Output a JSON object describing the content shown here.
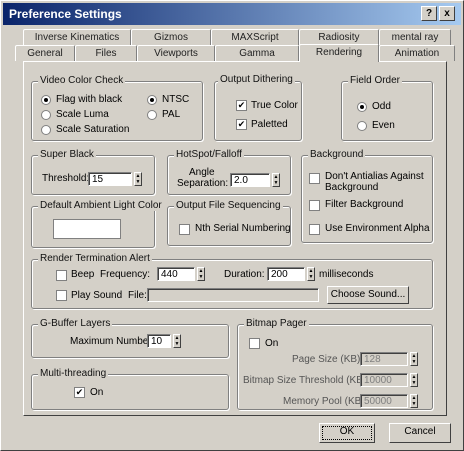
{
  "window": {
    "title": "Preference Settings",
    "help_glyph": "?",
    "close_glyph": "x"
  },
  "tabs_row1": [
    "Inverse Kinematics",
    "Gizmos",
    "MAXScript",
    "Radiosity",
    "mental ray"
  ],
  "tabs_row2": [
    "General",
    "Files",
    "Viewports",
    "Gamma",
    "Rendering",
    "Animation"
  ],
  "video_color_check": {
    "title": "Video Color Check",
    "method_options": [
      "Flag with black",
      "Scale Luma",
      "Scale Saturation"
    ],
    "method_selected": 0,
    "standard_options": [
      "NTSC",
      "PAL"
    ],
    "standard_selected": 0
  },
  "output_dithering": {
    "title": "Output Dithering",
    "options": [
      {
        "label": "True Color",
        "checked": true
      },
      {
        "label": "Paletted",
        "checked": true
      }
    ]
  },
  "field_order": {
    "title": "Field Order",
    "options": [
      "Odd",
      "Even"
    ],
    "selected": 0
  },
  "super_black": {
    "title": "Super Black",
    "threshold_label": "Threshold:",
    "threshold_value": "15"
  },
  "hotspot_falloff": {
    "title": "HotSpot/Falloff",
    "angle_label_1": "Angle",
    "angle_label_2": "Separation:",
    "angle_value": "2.0"
  },
  "background": {
    "title": "Background",
    "options": [
      {
        "label_1": "Don't Antialias Against",
        "label_2": "Background",
        "checked": false
      },
      {
        "label_1": "Filter Background",
        "label_2": "",
        "checked": false
      },
      {
        "label_1": "Use Environment Alpha",
        "label_2": "",
        "checked": false
      }
    ]
  },
  "ambient": {
    "title": "Default Ambient Light Color",
    "color": "#ffffff"
  },
  "output_file_seq": {
    "title": "Output File Sequencing",
    "option": "Nth Serial Numbering",
    "checked": false
  },
  "render_termination": {
    "title": "Render Termination Alert",
    "beep_label": "Beep",
    "beep_checked": false,
    "frequency_label": "Frequency:",
    "frequency_value": "440",
    "duration_label": "Duration:",
    "duration_value": "200",
    "duration_unit": "milliseconds",
    "play_sound_label": "Play Sound",
    "play_sound_checked": false,
    "file_label": "File:",
    "file_value": "",
    "choose_button": "Choose Sound..."
  },
  "gbuffer": {
    "title": "G-Buffer Layers",
    "max_label": "Maximum Number:",
    "max_value": "10"
  },
  "multithreading": {
    "title": "Multi-threading",
    "option": "On",
    "checked": true
  },
  "bitmap_pager": {
    "title": "Bitmap Pager",
    "on_label": "On",
    "on_checked": false,
    "page_size_label": "Page Size (KB):",
    "page_size_value": "128",
    "threshold_label": "Bitmap Size Threshold (KB):",
    "threshold_value": "10000",
    "pool_label": "Memory Pool (KB):",
    "pool_value": "50000"
  },
  "footer": {
    "ok": "OK",
    "cancel": "Cancel"
  }
}
